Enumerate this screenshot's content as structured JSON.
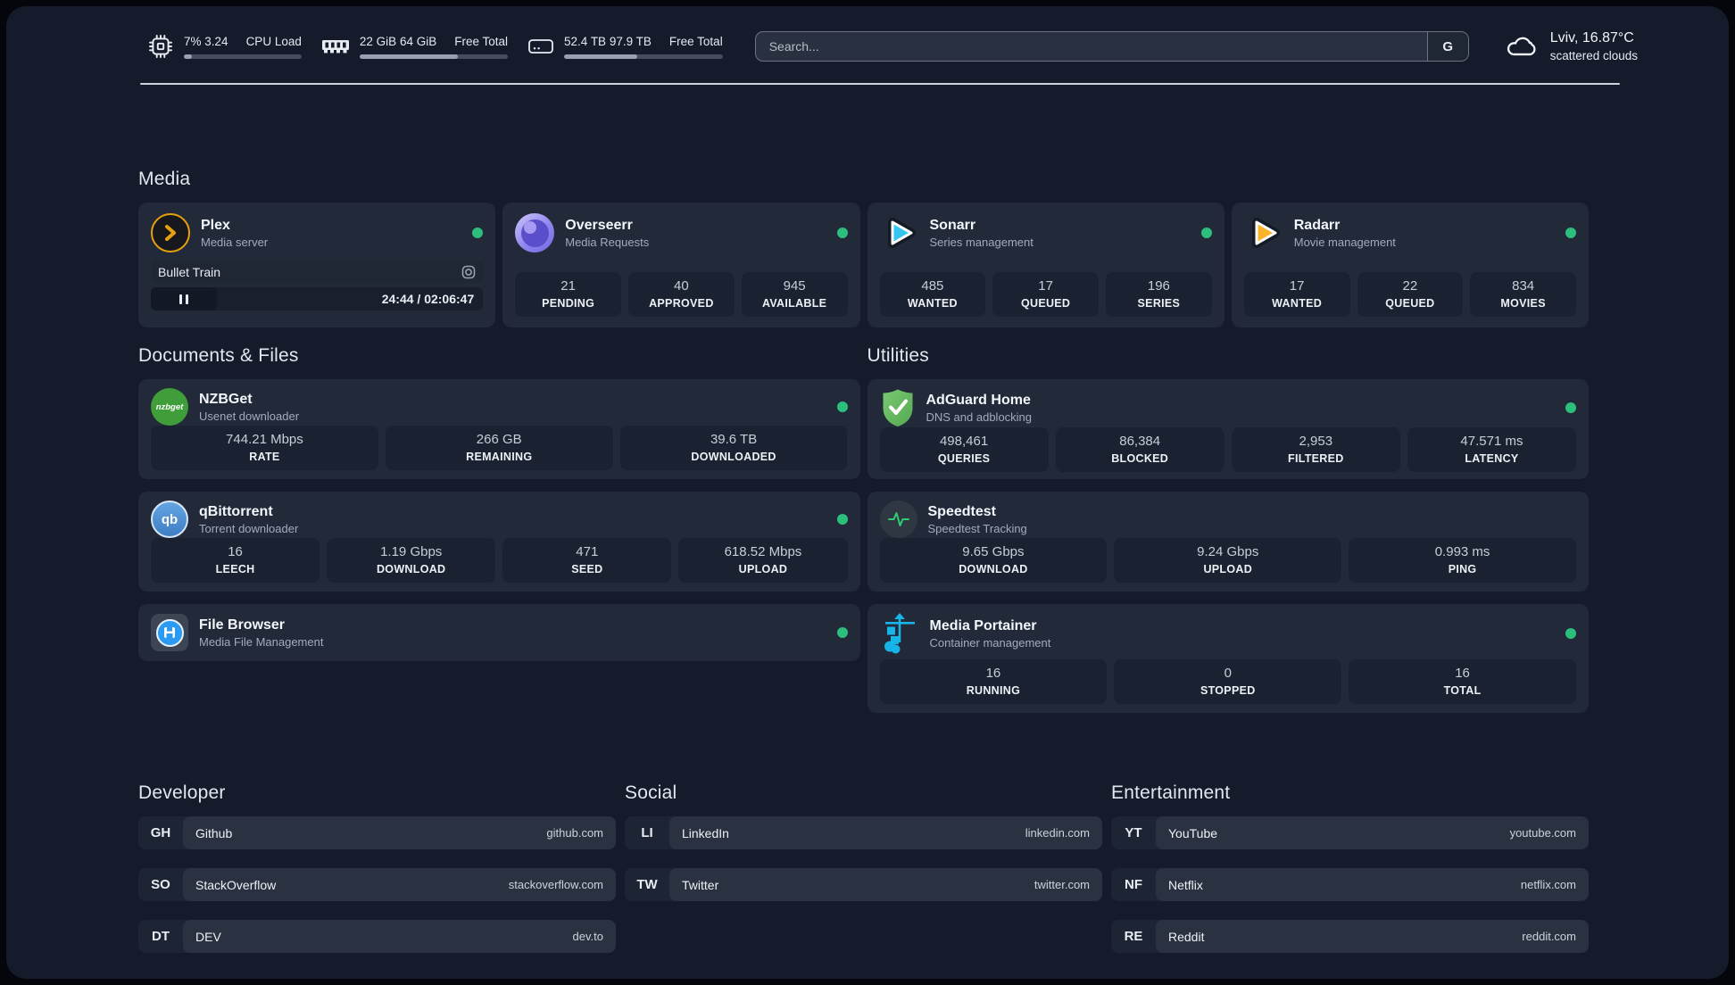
{
  "colors": {
    "page_bg": "#161b2b",
    "card_bg": "#222a39",
    "stat_bg": "#1a2130",
    "status_green": "#2dbe7d",
    "plex_amber": "#e5a00d",
    "sonarr_blue": "#35c5f1",
    "radarr_yellow": "#fbb329",
    "adguard_green": "#67b662",
    "portainer_blue": "#17b4e8",
    "speedtest_green": "#2ecc71",
    "divider": "#ccd2dd"
  },
  "header": {
    "metrics": [
      {
        "name": "cpu",
        "value_top": "7%",
        "value_bottom": "3.24",
        "label_top": "CPU",
        "label_bottom": "Load",
        "progress_percent": 7,
        "bar_style": "width:7%"
      },
      {
        "name": "memory",
        "value_top": "22 GiB",
        "value_bottom": "64 GiB",
        "label_top": "Free",
        "label_bottom": "Total",
        "progress_percent": 66,
        "bar_style": "width:66%"
      },
      {
        "name": "storage",
        "value_top": "52.4 TB",
        "value_bottom": "97.9 TB",
        "label_top": "Free",
        "label_bottom": "Total",
        "progress_percent": 46,
        "bar_style": "width:46%"
      }
    ],
    "search": {
      "placeholder": "Search...",
      "engine_button": "G"
    },
    "weather": {
      "location_temp": "Lviv, 16.87°C",
      "condition": "scattered clouds"
    }
  },
  "sections": {
    "media": "Media",
    "documents": "Documents & Files",
    "utilities": "Utilities",
    "developer": "Developer",
    "social": "Social",
    "entertainment": "Entertainment"
  },
  "apps": {
    "plex": {
      "name": "Plex",
      "description": "Media server",
      "status": "online",
      "player": {
        "title": "Bullet Train",
        "time": "24:44 / 02:06:47"
      }
    },
    "overseerr": {
      "name": "Overseerr",
      "description": "Media Requests",
      "status": "online",
      "stats": [
        {
          "value": "21",
          "label": "PENDING"
        },
        {
          "value": "40",
          "label": "APPROVED"
        },
        {
          "value": "945",
          "label": "AVAILABLE"
        }
      ]
    },
    "sonarr": {
      "name": "Sonarr",
      "description": "Series management",
      "status": "online",
      "stats": [
        {
          "value": "485",
          "label": "WANTED"
        },
        {
          "value": "17",
          "label": "QUEUED"
        },
        {
          "value": "196",
          "label": "SERIES"
        }
      ]
    },
    "radarr": {
      "name": "Radarr",
      "description": "Movie management",
      "status": "online",
      "stats": [
        {
          "value": "17",
          "label": "WANTED"
        },
        {
          "value": "22",
          "label": "QUEUED"
        },
        {
          "value": "834",
          "label": "MOVIES"
        }
      ]
    },
    "nzbget": {
      "name": "NZBGet",
      "description": "Usenet downloader",
      "status": "online",
      "icon_text": "nzbget",
      "stats": [
        {
          "value": "744.21 Mbps",
          "label": "RATE"
        },
        {
          "value": "266 GB",
          "label": "REMAINING"
        },
        {
          "value": "39.6 TB",
          "label": "DOWNLOADED"
        }
      ]
    },
    "qbittorrent": {
      "name": "qBittorrent",
      "description": "Torrent downloader",
      "status": "online",
      "icon_text": "qb",
      "stats": [
        {
          "value": "16",
          "label": "LEECH"
        },
        {
          "value": "1.19 Gbps",
          "label": "DOWNLOAD"
        },
        {
          "value": "471",
          "label": "SEED"
        },
        {
          "value": "618.52 Mbps",
          "label": "UPLOAD"
        }
      ]
    },
    "filebrowser": {
      "name": "File Browser",
      "description": "Media File Management",
      "status": "online"
    },
    "adguard": {
      "name": "AdGuard Home",
      "description": "DNS and adblocking",
      "status": "online",
      "stats": [
        {
          "value": "498,461",
          "label": "QUERIES"
        },
        {
          "value": "86,384",
          "label": "BLOCKED"
        },
        {
          "value": "2,953",
          "label": "FILTERED"
        },
        {
          "value": "47.571 ms",
          "label": "LATENCY"
        }
      ]
    },
    "speedtest": {
      "name": "Speedtest",
      "description": "Speedtest Tracking",
      "stats": [
        {
          "value": "9.65 Gbps",
          "label": "DOWNLOAD"
        },
        {
          "value": "9.24 Gbps",
          "label": "UPLOAD"
        },
        {
          "value": "0.993 ms",
          "label": "PING"
        }
      ]
    },
    "portainer": {
      "name": "Media Portainer",
      "description": "Container management",
      "status": "online",
      "stats": [
        {
          "value": "16",
          "label": "RUNNING"
        },
        {
          "value": "0",
          "label": "STOPPED"
        },
        {
          "value": "16",
          "label": "TOTAL"
        }
      ]
    }
  },
  "links": {
    "developer": [
      {
        "abbr": "GH",
        "name": "Github",
        "url": "github.com"
      },
      {
        "abbr": "SO",
        "name": "StackOverflow",
        "url": "stackoverflow.com"
      },
      {
        "abbr": "DT",
        "name": "DEV",
        "url": "dev.to"
      }
    ],
    "social": [
      {
        "abbr": "LI",
        "name": "LinkedIn",
        "url": "linkedin.com"
      },
      {
        "abbr": "TW",
        "name": "Twitter",
        "url": "twitter.com"
      }
    ],
    "entertainment": [
      {
        "abbr": "YT",
        "name": "YouTube",
        "url": "youtube.com"
      },
      {
        "abbr": "NF",
        "name": "Netflix",
        "url": "netflix.com"
      },
      {
        "abbr": "RE",
        "name": "Reddit",
        "url": "reddit.com"
      }
    ]
  }
}
